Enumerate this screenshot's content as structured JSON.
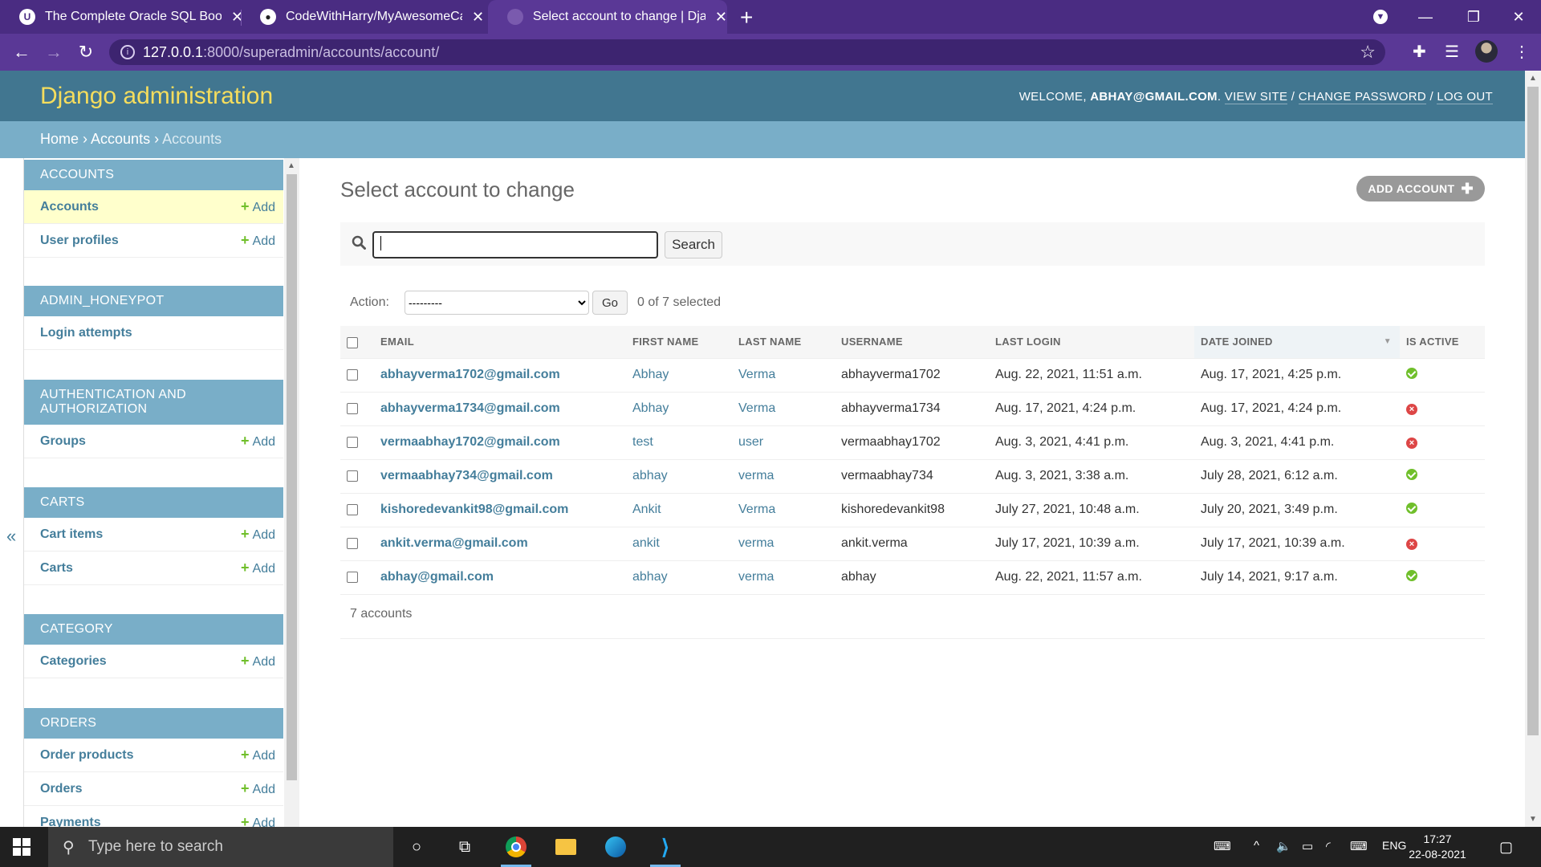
{
  "browser": {
    "tabs": [
      {
        "title": "The Complete Oracle SQL Bootca",
        "active": false
      },
      {
        "title": "CodeWithHarry/MyAwesomeCar",
        "active": false
      },
      {
        "title": "Select account to change | Djang",
        "active": true
      }
    ],
    "url_host": "127.0.0.1",
    "url_rest": ":8000/superadmin/accounts/account/"
  },
  "header": {
    "branding": "Django administration",
    "welcome": "WELCOME, ",
    "user": "ABHAY@GMAIL.COM",
    "view_site": "VIEW SITE",
    "change_password": "CHANGE PASSWORD",
    "log_out": "LOG OUT"
  },
  "breadcrumbs": {
    "home": "Home",
    "app": "Accounts",
    "current": "Accounts"
  },
  "sidebar": {
    "toggle": "«",
    "add_label": "Add",
    "modules": [
      {
        "title": "ACCOUNTS",
        "items": [
          {
            "label": "Accounts",
            "add": true
          },
          {
            "label": "User profiles",
            "add": true
          }
        ]
      },
      {
        "title": "ADMIN_HONEYPOT",
        "items": [
          {
            "label": "Login attempts",
            "add": false
          }
        ]
      },
      {
        "title": "AUTHENTICATION AND AUTHORIZATION",
        "items": [
          {
            "label": "Groups",
            "add": true
          }
        ]
      },
      {
        "title": "CARTS",
        "items": [
          {
            "label": "Cart items",
            "add": true
          },
          {
            "label": "Carts",
            "add": true
          }
        ]
      },
      {
        "title": "CATEGORY",
        "items": [
          {
            "label": "Categories",
            "add": true
          }
        ]
      },
      {
        "title": "ORDERS",
        "items": [
          {
            "label": "Order products",
            "add": true
          },
          {
            "label": "Orders",
            "add": true
          },
          {
            "label": "Payments",
            "add": true
          }
        ]
      }
    ]
  },
  "content": {
    "title": "Select account to change",
    "add_button": "ADD ACCOUNT",
    "search_button": "Search",
    "action_label": "Action:",
    "action_default": "---------",
    "go_button": "Go",
    "selected_text": "0 of 7 selected",
    "columns": [
      "EMAIL",
      "FIRST NAME",
      "LAST NAME",
      "USERNAME",
      "LAST LOGIN",
      "DATE JOINED",
      "IS ACTIVE"
    ],
    "rows": [
      {
        "email": "abhayverma1702@gmail.com",
        "first": "Abhay",
        "last": "Verma",
        "username": "abhayverma1702",
        "last_login": "Aug. 22, 2021, 11:51 a.m.",
        "joined": "Aug. 17, 2021, 4:25 p.m.",
        "active": true
      },
      {
        "email": "abhayverma1734@gmail.com",
        "first": "Abhay",
        "last": "Verma",
        "username": "abhayverma1734",
        "last_login": "Aug. 17, 2021, 4:24 p.m.",
        "joined": "Aug. 17, 2021, 4:24 p.m.",
        "active": false
      },
      {
        "email": "vermaabhay1702@gmail.com",
        "first": "test",
        "last": "user",
        "username": "vermaabhay1702",
        "last_login": "Aug. 3, 2021, 4:41 p.m.",
        "joined": "Aug. 3, 2021, 4:41 p.m.",
        "active": false
      },
      {
        "email": "vermaabhay734@gmail.com",
        "first": "abhay",
        "last": "verma",
        "username": "vermaabhay734",
        "last_login": "Aug. 3, 2021, 3:38 a.m.",
        "joined": "July 28, 2021, 6:12 a.m.",
        "active": true
      },
      {
        "email": "kishoredevankit98@gmail.com",
        "first": "Ankit",
        "last": "Verma",
        "username": "kishoredevankit98",
        "last_login": "July 27, 2021, 10:48 a.m.",
        "joined": "July 20, 2021, 3:49 p.m.",
        "active": true
      },
      {
        "email": "ankit.verma@gmail.com",
        "first": "ankit",
        "last": "verma",
        "username": "ankit.verma",
        "last_login": "July 17, 2021, 10:39 a.m.",
        "joined": "July 17, 2021, 10:39 a.m.",
        "active": false
      },
      {
        "email": "abhay@gmail.com",
        "first": "abhay",
        "last": "verma",
        "username": "abhay",
        "last_login": "Aug. 22, 2021, 11:57 a.m.",
        "joined": "July 14, 2021, 9:17 a.m.",
        "active": true
      }
    ],
    "count_text": "7 accounts"
  },
  "taskbar": {
    "search_placeholder": "Type here to search",
    "lang": "ENG",
    "time": "17:27",
    "date": "22-08-2021"
  }
}
